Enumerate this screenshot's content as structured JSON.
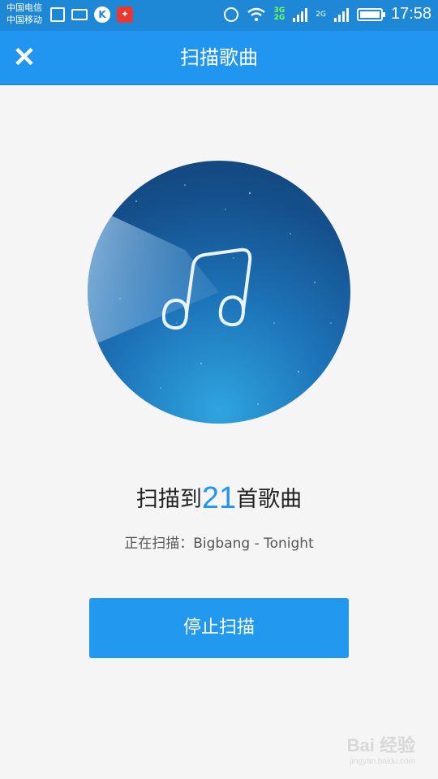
{
  "status_bar": {
    "carrier_1": "中国电信",
    "carrier_2": "中国移动",
    "net_3g": "3G",
    "net_2g_a": "2G",
    "net_2g_b": "2G",
    "time": "17:58",
    "k_app_label": "K"
  },
  "header": {
    "title": "扫描歌曲",
    "close_icon": "close-icon"
  },
  "result": {
    "prefix": "扫描到",
    "count": "21",
    "suffix": "首歌曲"
  },
  "scanning": {
    "label": "正在扫描：",
    "current": "Bigbang - Tonight"
  },
  "stop_button": {
    "label": "停止扫描"
  },
  "watermark": {
    "brand": "Bai 经验",
    "url": "jingyan.baidu.com"
  },
  "colors": {
    "accent": "#2196f0",
    "status_bar": "#1e88d7",
    "background": "#f5f5f5"
  }
}
